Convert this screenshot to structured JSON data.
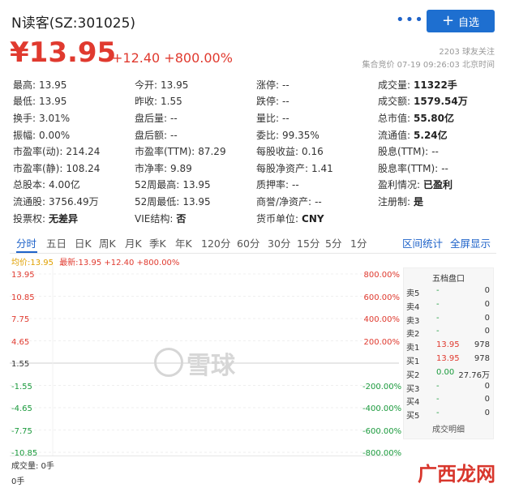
{
  "header": {
    "title": "N读客(SZ:301025)",
    "more_icon": "more-dots-icon",
    "follow_label": "自选",
    "price": "¥13.95",
    "change": "+12.40 +800.00%",
    "fans": "2203 球友关注",
    "time": "集合竞价 07-19 09:26:03 北京时间"
  },
  "stats": [
    [
      {
        "l": "最高:",
        "v": "13.95",
        "c": "red"
      },
      {
        "l": "今开:",
        "v": "13.95",
        "c": "red"
      },
      {
        "l": "涨停:",
        "v": "--",
        "c": ""
      },
      {
        "l": "成交量:",
        "v": "11322手",
        "c": "bold"
      }
    ],
    [
      {
        "l": "最低:",
        "v": "13.95",
        "c": "red"
      },
      {
        "l": "昨收:",
        "v": "1.55",
        "c": ""
      },
      {
        "l": "跌停:",
        "v": "--",
        "c": ""
      },
      {
        "l": "成交额:",
        "v": "1579.54万",
        "c": "bold"
      }
    ],
    [
      {
        "l": "换手:",
        "v": "3.01%",
        "c": ""
      },
      {
        "l": "盘后量:",
        "v": "--",
        "c": ""
      },
      {
        "l": "量比:",
        "v": "--",
        "c": ""
      },
      {
        "l": "总市值:",
        "v": "55.80亿",
        "c": "bold"
      }
    ],
    [
      {
        "l": "振幅:",
        "v": "0.00%",
        "c": ""
      },
      {
        "l": "盘后额:",
        "v": "--",
        "c": ""
      },
      {
        "l": "委比:",
        "v": "99.35%",
        "c": "red"
      },
      {
        "l": "流通值:",
        "v": "5.24亿",
        "c": "bold"
      }
    ],
    [
      {
        "l": "市盈率(动):",
        "v": "214.24",
        "c": ""
      },
      {
        "l": "市盈率(TTM):",
        "v": "87.29",
        "c": ""
      },
      {
        "l": "每股收益:",
        "v": "0.16",
        "c": ""
      },
      {
        "l": "股息(TTM):",
        "v": "--",
        "c": ""
      }
    ],
    [
      {
        "l": "市盈率(静):",
        "v": "108.24",
        "c": ""
      },
      {
        "l": "市净率:",
        "v": "9.89",
        "c": ""
      },
      {
        "l": "每股净资产:",
        "v": "1.41",
        "c": ""
      },
      {
        "l": "股息率(TTM):",
        "v": "--",
        "c": ""
      }
    ],
    [
      {
        "l": "总股本:",
        "v": "4.00亿",
        "c": ""
      },
      {
        "l": "52周最高:",
        "v": "13.95",
        "c": ""
      },
      {
        "l": "质押率:",
        "v": "--",
        "c": ""
      },
      {
        "l": "盈利情况:",
        "v": "已盈利",
        "c": "bold"
      }
    ],
    [
      {
        "l": "流通股:",
        "v": "3756.49万",
        "c": ""
      },
      {
        "l": "52周最低:",
        "v": "13.95",
        "c": ""
      },
      {
        "l": "商誉/净资产:",
        "v": "--",
        "c": ""
      },
      {
        "l": "注册制:",
        "v": "是",
        "c": "bold"
      }
    ],
    [
      {
        "l": "投票权:",
        "v": "无差异",
        "c": "bold"
      },
      {
        "l": "VIE结构:",
        "v": "否",
        "c": "bold"
      },
      {
        "l": "货币单位:",
        "v": "CNY",
        "c": "bold"
      },
      {
        "l": "",
        "v": "",
        "c": ""
      }
    ]
  ],
  "tabs": [
    "分时",
    "五日",
    "日K",
    "周K",
    "月K",
    "季K",
    "年K",
    "120分",
    "60分",
    "30分",
    "15分",
    "5分",
    "1分"
  ],
  "tab_links": [
    "区间统计",
    "全屏显示"
  ],
  "legend": {
    "avg": "均价:13.95",
    "latest": "最新:13.95 +12.40 +800.00%"
  },
  "chart_data": {
    "type": "line",
    "left_axis": [
      "13.95",
      "10.85",
      "7.75",
      "4.65",
      "1.55",
      "-1.55",
      "-4.65",
      "-7.75",
      "-10.85"
    ],
    "right_axis": [
      "800.00%",
      "600.00%",
      "400.00%",
      "200.00%",
      "",
      "-200.00%",
      "-400.00%",
      "-600.00%",
      "-800.00%"
    ],
    "series": []
  },
  "order_book": {
    "title": "五档盘口",
    "rows": [
      {
        "label": "卖5",
        "price": "-",
        "vol": "0",
        "pc": "green"
      },
      {
        "label": "卖4",
        "price": "-",
        "vol": "0",
        "pc": "green"
      },
      {
        "label": "卖3",
        "price": "-",
        "vol": "0",
        "pc": "green"
      },
      {
        "label": "卖2",
        "price": "-",
        "vol": "0",
        "pc": "green"
      },
      {
        "label": "卖1",
        "price": "13.95",
        "vol": "978",
        "pc": "red"
      },
      {
        "label": "买1",
        "price": "13.95",
        "vol": "978",
        "pc": "red"
      },
      {
        "label": "买2",
        "price": "0.00",
        "vol": "27.76万",
        "pc": "green"
      },
      {
        "label": "买3",
        "price": "-",
        "vol": "0",
        "pc": "green"
      },
      {
        "label": "买4",
        "price": "-",
        "vol": "0",
        "pc": "green"
      },
      {
        "label": "买5",
        "price": "-",
        "vol": "0",
        "pc": "green"
      }
    ],
    "footer": "成交明细"
  },
  "volume": {
    "label": "成交量: 0手",
    "zero": "0手"
  },
  "watermark": "雪球",
  "site_mark": "广西龙网"
}
